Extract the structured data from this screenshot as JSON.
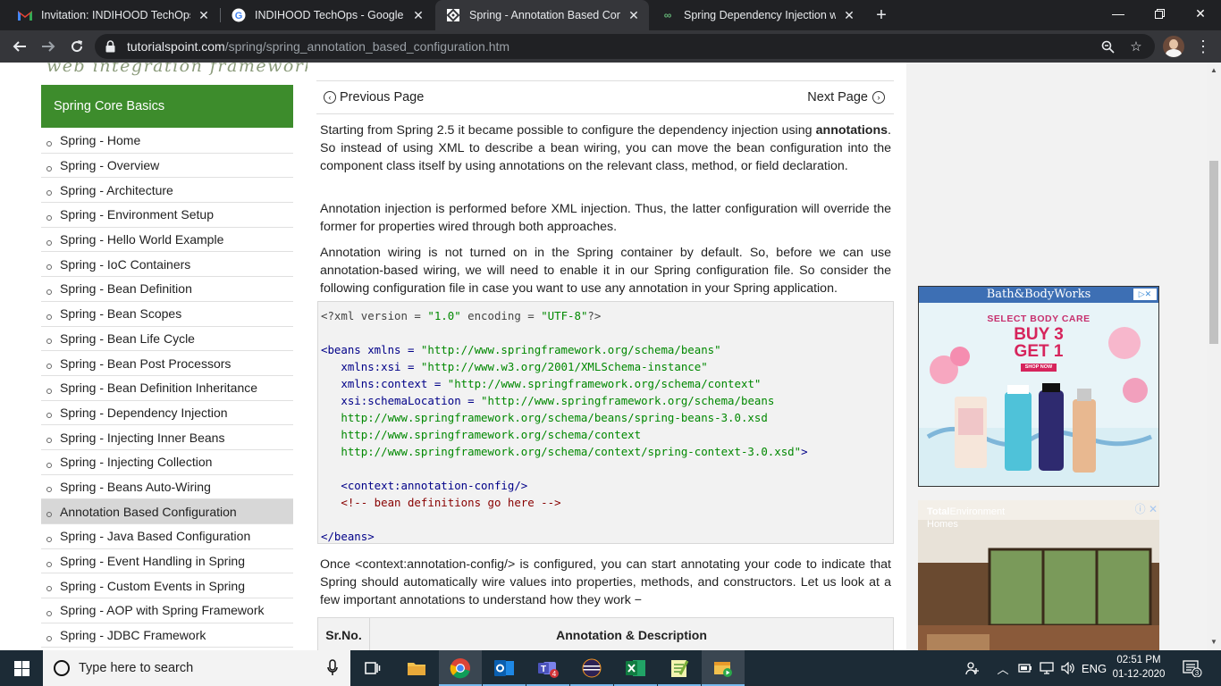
{
  "browser": {
    "tabs": [
      {
        "title": "Invitation: INDIHOOD TechOps (T",
        "icon": "gmail-icon",
        "active": false
      },
      {
        "title": "INDIHOOD TechOps - Google Se",
        "icon": "google-icon",
        "active": false
      },
      {
        "title": "Spring - Annotation Based Config",
        "icon": "tutorialspoint-icon",
        "active": true
      },
      {
        "title": "Spring Dependency Injection wit",
        "icon": "baeldung-icon",
        "active": false
      }
    ],
    "url_host": "tutorialspoint.com",
    "url_path": "/spring/spring_annotation_based_configuration.htm"
  },
  "sidebar": {
    "logo_tagline": "web integration framework",
    "heading": "Spring Core Basics",
    "items": [
      "Spring - Home",
      "Spring - Overview",
      "Spring - Architecture",
      "Spring - Environment Setup",
      "Spring - Hello World Example",
      "Spring - IoC Containers",
      "Spring - Bean Definition",
      "Spring - Bean Scopes",
      "Spring - Bean Life Cycle",
      "Spring - Bean Post Processors",
      "Spring - Bean Definition Inheritance",
      "Spring - Dependency Injection",
      "Spring - Injecting Inner Beans",
      "Spring - Injecting Collection",
      "Spring - Beans Auto-Wiring",
      "Annotation Based Configuration",
      "Spring - Java Based Configuration",
      "Spring - Event Handling in Spring",
      "Spring - Custom Events in Spring",
      "Spring - AOP with Spring Framework",
      "Spring - JDBC Framework"
    ],
    "active_index": 15
  },
  "pager": {
    "prev": "Previous Page",
    "next": "Next Page"
  },
  "content": {
    "p1_before": "Starting from Spring 2.5 it became possible to configure the dependency injection using ",
    "p1_bold": "annotations",
    "p1_after": ". So instead of using XML to describe a bean wiring, you can move the bean configuration into the component class itself by using annotations on the relevant class, method, or field declaration.",
    "p2": "Annotation injection is performed before XML injection. Thus, the latter configuration will override the former for properties wired through both approaches.",
    "p3": "Annotation wiring is not turned on in the Spring container by default. So, before we can use annotation-based wiring, we will need to enable it in our Spring configuration file. So consider the following configuration file in case you want to use any annotation in your Spring application.",
    "code": {
      "l1_a": "<?xml version = ",
      "l1_b": "\"1.0\"",
      "l1_c": " encoding = ",
      "l1_d": "\"UTF-8\"",
      "l1_e": "?>",
      "l3_a": "<beans xmlns = ",
      "l3_b": "\"http://www.springframework.org/schema/beans\"",
      "l4_a": "   xmlns:xsi = ",
      "l4_b": "\"http://www.w3.org/2001/XMLSchema-instance\"",
      "l5_a": "   xmlns:context = ",
      "l5_b": "\"http://www.springframework.org/schema/context\"",
      "l6_a": "   xsi:schemaLocation = ",
      "l6_b": "\"http://www.springframework.org/schema/beans",
      "l7": "   http://www.springframework.org/schema/beans/spring-beans-3.0.xsd",
      "l8": "   http://www.springframework.org/schema/context",
      "l9_a": "   http://www.springframework.org/schema/context/spring-context-3.0.xsd\"",
      "l9_b": ">",
      "l11": "   <context:annotation-config/>",
      "l12": "   <!-- bean definitions go here -->",
      "l14": "</beans>"
    },
    "p4": "Once <context:annotation-config/> is configured, you can start annotating your code to indicate that Spring should automatically wire values into properties, methods, and constructors. Let us look at a few important annotations to understand how they work −",
    "table_headers": [
      "Sr.No.",
      "Annotation & Description"
    ]
  },
  "ads": {
    "ad1_brand": "Bath&BodyWorks",
    "ad1_line1": "SELECT BODY CARE",
    "ad1_line2": "BUY 3",
    "ad1_line3": "GET 1",
    "ad1_shop": "SHOP NOW",
    "ad2_brand_bold": "Total",
    "ad2_brand_rest": "Environment",
    "ad2_sub": "Homes"
  },
  "taskbar": {
    "search_placeholder": "Type here to search",
    "lang": "ENG",
    "time": "02:51 PM",
    "date": "01-12-2020",
    "notification_count": "3"
  },
  "colors": {
    "sidebar_heading_bg": "#3d8c2c",
    "browser_frame": "#202124",
    "taskbar": "#1c2b36"
  }
}
